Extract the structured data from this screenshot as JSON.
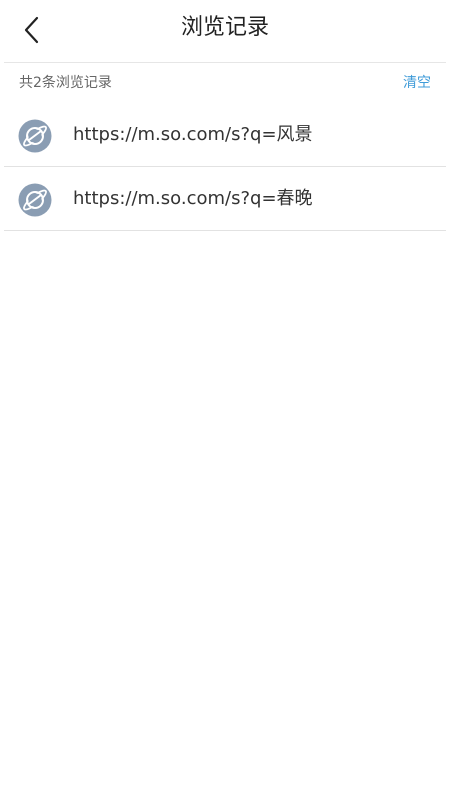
{
  "header": {
    "title": "浏览记录",
    "back_icon": "chevron-left-icon"
  },
  "summary": {
    "count_text": "共2条浏览记录",
    "clear_label": "清空",
    "clear_color": "#3f9bd8"
  },
  "history": {
    "item_icon": "planet-icon",
    "icon_color": "#8a9db3",
    "items": [
      {
        "url": "https://m.so.com/s?q=风景"
      },
      {
        "url": "https://m.so.com/s?q=春晚"
      }
    ]
  }
}
